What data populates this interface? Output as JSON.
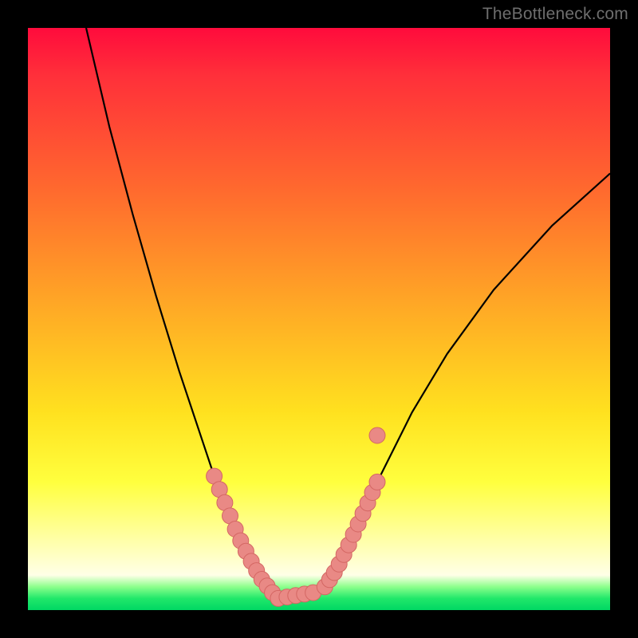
{
  "watermark": "TheBottleneck.com",
  "chart_data": {
    "type": "line",
    "title": "",
    "xlabel": "",
    "ylabel": "",
    "xlim": [
      0,
      100
    ],
    "ylim": [
      0,
      100
    ],
    "grid": false,
    "series": [
      {
        "name": "curve",
        "x": [
          10,
          14,
          18,
          22,
          26,
          30,
          32,
          34,
          36,
          38,
          40,
          42,
          43.5,
          45,
          47,
          49,
          51,
          53,
          55,
          60,
          66,
          72,
          80,
          90,
          100
        ],
        "y": [
          100,
          83,
          68,
          54,
          41,
          29,
          23,
          18,
          13,
          9,
          5.5,
          3,
          2,
          2,
          2,
          2.5,
          4,
          7,
          11,
          22,
          34,
          44,
          55,
          66,
          75
        ]
      }
    ],
    "marker_clusters": [
      {
        "name": "left-thigh",
        "x_range": [
          32,
          42
        ],
        "y_range": [
          3,
          28
        ],
        "count": 12
      },
      {
        "name": "valley",
        "x_range": [
          43,
          49
        ],
        "y_range": [
          2,
          3
        ],
        "count": 5
      },
      {
        "name": "right-thigh",
        "x_range": [
          51,
          60
        ],
        "y_range": [
          4,
          26
        ],
        "count": 12
      },
      {
        "name": "outlier-right",
        "x_range": [
          59,
          61
        ],
        "y_range": [
          29,
          31
        ],
        "count": 1
      }
    ],
    "marker_style": {
      "fill": "#e98985",
      "stroke": "#d46763",
      "radius_px": 10
    }
  }
}
